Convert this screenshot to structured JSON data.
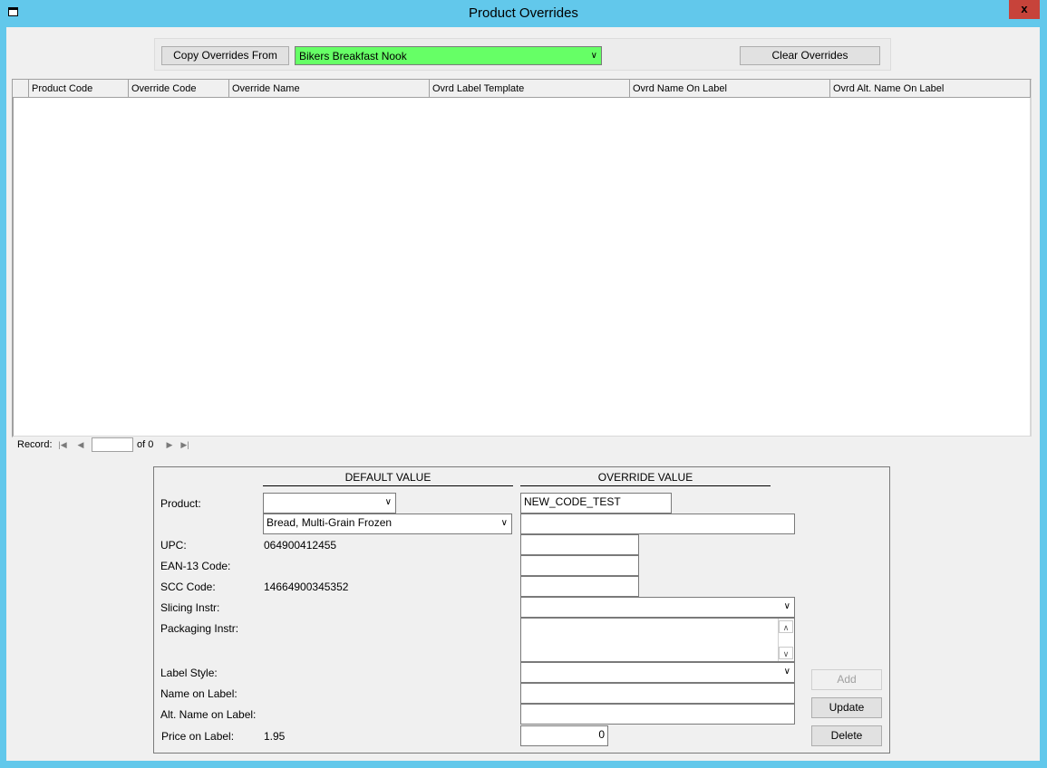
{
  "window": {
    "title": "Product Overrides",
    "close_glyph": "x"
  },
  "toolbar": {
    "copy_label": "Copy Overrides From",
    "copy_from_value": "Bikers Breakfast Nook",
    "clear_label": "Clear Overrides"
  },
  "grid": {
    "columns": [
      "Product Code",
      "Override Code",
      "Override Name",
      "Ovrd Label Template",
      "Ovrd Name On Label",
      "Ovrd Alt. Name On Label"
    ],
    "rows": []
  },
  "record_nav": {
    "label": "Record:",
    "current": "",
    "of_text": "of 0"
  },
  "form": {
    "default_header": "DEFAULT VALUE",
    "override_header": "OVERRIDE VALUE",
    "labels": {
      "product": "Product:",
      "upc": "UPC:",
      "ean13": "EAN-13 Code:",
      "scc": "SCC Code:",
      "slicing": "Slicing Instr:",
      "packaging": "Packaging Instr:",
      "label_style": "Label Style:",
      "name_on_label": "Name on Label:",
      "alt_name": "Alt. Name on Label:",
      "price": "Price on Label:"
    },
    "defaults": {
      "product_code": "",
      "product_name": "Bread, Multi-Grain Frozen",
      "upc": "064900412455",
      "ean13": "",
      "scc": "14664900345352",
      "price": "1.95"
    },
    "overrides": {
      "product_code": "NEW_CODE_TEST",
      "product_name": "",
      "upc": "",
      "ean13": "",
      "scc": "",
      "slicing": "",
      "packaging": "",
      "label_style": "",
      "name_on_label": "",
      "alt_name": "",
      "price": "0"
    },
    "buttons": {
      "add": "Add",
      "update": "Update",
      "delete": "Delete"
    }
  }
}
